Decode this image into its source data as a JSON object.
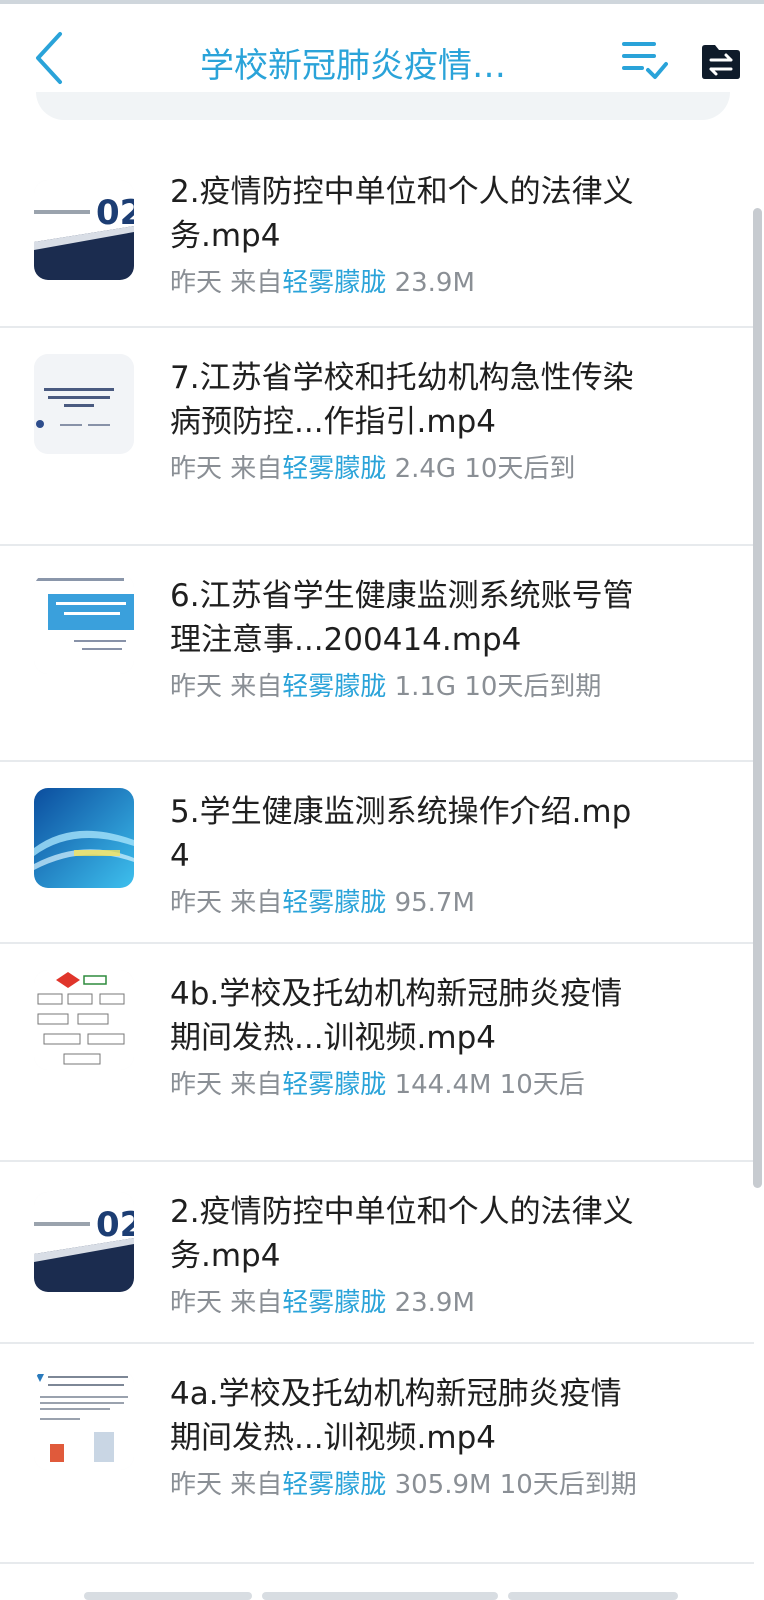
{
  "header": {
    "title": "学校新冠肺炎疫情…",
    "back_icon": "chevron-left-icon",
    "sort_icon": "sort-check-icon",
    "folder_icon": "folder-switch-icon"
  },
  "colors": {
    "accent": "#2aa3d9",
    "meta": "#8a8f95",
    "divider": "#e7eaed"
  },
  "files": [
    {
      "name": "2.疫情防控中单位和个人的法律义务.mp4",
      "date": "昨天",
      "from_label": "来自",
      "source": "轻雾朦胧",
      "size": "23.9M",
      "expiry": "",
      "thumb": "doc-02-icon"
    },
    {
      "name": "7.江苏省学校和托幼机构急性传染病预防控...作指引.mp4",
      "date": "昨天",
      "from_label": "来自",
      "source": "轻雾朦胧",
      "size": "2.4G",
      "expiry": "10天后到",
      "thumb": "doc-slide-icon"
    },
    {
      "name": "6.江苏省学生健康监测系统账号管理注意事...200414.mp4",
      "date": "昨天",
      "from_label": "来自",
      "source": "轻雾朦胧",
      "size": "1.1G",
      "expiry": "10天后到期",
      "thumb": "doc-blue-banner-icon"
    },
    {
      "name": "5.学生健康监测系统操作介绍.mp4",
      "date": "昨天",
      "from_label": "来自",
      "source": "轻雾朦胧",
      "size": "95.7M",
      "expiry": "",
      "thumb": "blue-wave-icon"
    },
    {
      "name": "4b.学校及托幼机构新冠肺炎疫情期间发热...训视频.mp4",
      "date": "昨天",
      "from_label": "来自",
      "source": "轻雾朦胧",
      "size": "144.4M",
      "expiry": "10天后",
      "thumb": "flowchart-icon"
    },
    {
      "name": "2.疫情防控中单位和个人的法律义务.mp4",
      "date": "昨天",
      "from_label": "来自",
      "source": "轻雾朦胧",
      "size": "23.9M",
      "expiry": "",
      "thumb": "doc-02-icon"
    },
    {
      "name": "4a.学校及托幼机构新冠肺炎疫情期间发热...训视频.mp4",
      "date": "昨天",
      "from_label": "来自",
      "source": "轻雾朦胧",
      "size": "305.9M",
      "expiry": "10天后到期",
      "thumb": "doc-text-icon"
    }
  ]
}
